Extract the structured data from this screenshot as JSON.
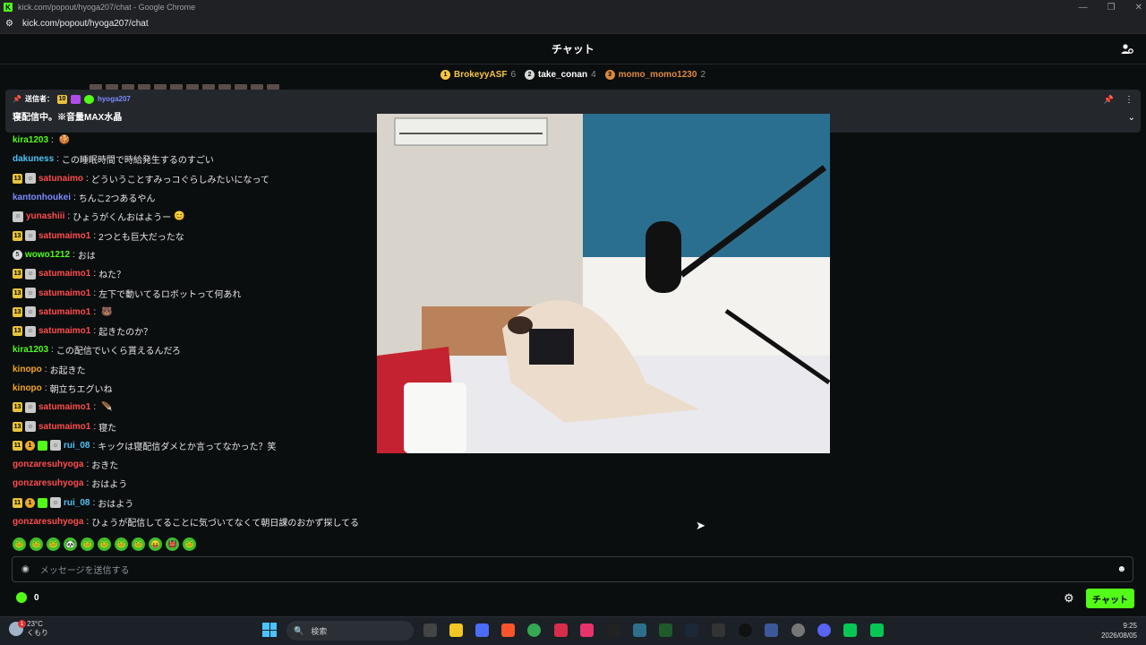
{
  "window": {
    "title": "kick.com/popout/hyoga207/chat - Google Chrome",
    "url": "kick.com/popout/hyoga207/chat",
    "favicon": "K"
  },
  "header": {
    "title": "チャット"
  },
  "leaderboard": [
    {
      "rank": "1",
      "name": "BrokeyyASF",
      "count": "6",
      "color": "#f5c542",
      "rank_color": "#f5c542"
    },
    {
      "rank": "2",
      "name": "take_conan",
      "count": "4",
      "color": "#ffffff",
      "rank_color": "#d8d8d8"
    },
    {
      "rank": "3",
      "name": "momo_momo1230",
      "count": "2",
      "color": "#e08a3c",
      "rank_color": "#d98a3c"
    }
  ],
  "pinned": {
    "label": "送信者：",
    "badge": "10",
    "user": "hyoga207",
    "message": "寝配信中。※音量MAX水晶"
  },
  "messages": [
    {
      "badges": [],
      "user": "kira1203",
      "color": "#53fc18",
      "text": "",
      "emote": "🍪"
    },
    {
      "badges": [],
      "user": "dakuness",
      "color": "#4fc3f7",
      "text": "この睡眠時間で時給発生するのすごい"
    },
    {
      "badges": [
        "sub:13",
        "avatar"
      ],
      "user": "satunaimo",
      "color": "#ff4d4d",
      "text": "どういうことすみっコぐらしみたいになって"
    },
    {
      "badges": [],
      "user": "kantonhoukei",
      "color": "#7b8cff",
      "text": "ちんこ2つあるやん"
    },
    {
      "badges": [
        "avatar"
      ],
      "user": "yunashiii",
      "color": "#ff4d4d",
      "text": "ひょうがくんおはようー",
      "emote": "😊"
    },
    {
      "badges": [
        "sub:13",
        "avatar"
      ],
      "user": "satumaimo1",
      "color": "#ff4d4d",
      "text": "2つとも巨大だったな"
    },
    {
      "badges": [
        "rank:5"
      ],
      "user": "wowo1212",
      "color": "#53fc18",
      "text": "おは"
    },
    {
      "badges": [
        "sub:13",
        "avatar"
      ],
      "user": "satumaimo1",
      "color": "#ff4d4d",
      "text": "ねた？"
    },
    {
      "badges": [
        "sub:13",
        "avatar"
      ],
      "user": "satumaimo1",
      "color": "#ff4d4d",
      "text": "左下で動いてるロボットって何あれ"
    },
    {
      "badges": [
        "sub:13",
        "avatar"
      ],
      "user": "satumaimo1",
      "color": "#ff4d4d",
      "text": "",
      "emote": "🐻"
    },
    {
      "badges": [
        "sub:13",
        "avatar"
      ],
      "user": "satumaimo1",
      "color": "#ff4d4d",
      "text": "起きたのか？"
    },
    {
      "badges": [],
      "user": "kira1203",
      "color": "#53fc18",
      "text": "この配信でいくら貰えるんだろ"
    },
    {
      "badges": [],
      "user": "kinopo",
      "color": "#f5a623",
      "text": "お起きた"
    },
    {
      "badges": [],
      "user": "kinopo",
      "color": "#f5a623",
      "text": "朝立ちエグいね"
    },
    {
      "badges": [
        "sub:13",
        "avatar"
      ],
      "user": "satumaimo1",
      "color": "#ff4d4d",
      "text": "",
      "emote": "🪶"
    },
    {
      "badges": [
        "sub:13",
        "avatar"
      ],
      "user": "satumaimo1",
      "color": "#ff4d4d",
      "text": "寝た"
    },
    {
      "badges": [
        "sub:11",
        "coin",
        "gift",
        "avatar"
      ],
      "user": "rui_08",
      "color": "#4fc3f7",
      "text": "キックは寝配信ダメとか言ってなかった？笑"
    },
    {
      "badges": [],
      "user": "gonzaresuhyoga",
      "color": "#ff4d4d",
      "text": "おきた"
    },
    {
      "badges": [],
      "user": "gonzaresuhyoga",
      "color": "#ff4d4d",
      "text": "おはよう"
    },
    {
      "badges": [
        "sub:11",
        "coin",
        "gift",
        "avatar"
      ],
      "user": "rui_08",
      "color": "#4fc3f7",
      "text": "おはよう"
    },
    {
      "badges": [],
      "user": "gonzaresuhyoga",
      "color": "#ff4d4d",
      "text": "ひょうが配信してることに気づいてなくて朝日課のおかず探してる"
    }
  ],
  "emote_bar": [
    "🐸",
    "🐸",
    "🐸",
    "🐼",
    "🐸",
    "🐸",
    "🐸",
    "🐸",
    "😝",
    "👹",
    "🐸"
  ],
  "input": {
    "placeholder": "メッセージを送信する"
  },
  "footer": {
    "points": "0",
    "send_label": "チャット"
  },
  "taskbar": {
    "weather_temp": "23°C",
    "weather_desc": "くもり",
    "weather_badge": "1",
    "search_placeholder": "検索",
    "time": "9:25",
    "date": "2026/08/05"
  },
  "colors": {
    "accent": "#53fc18",
    "background": "#0b0e0f"
  }
}
